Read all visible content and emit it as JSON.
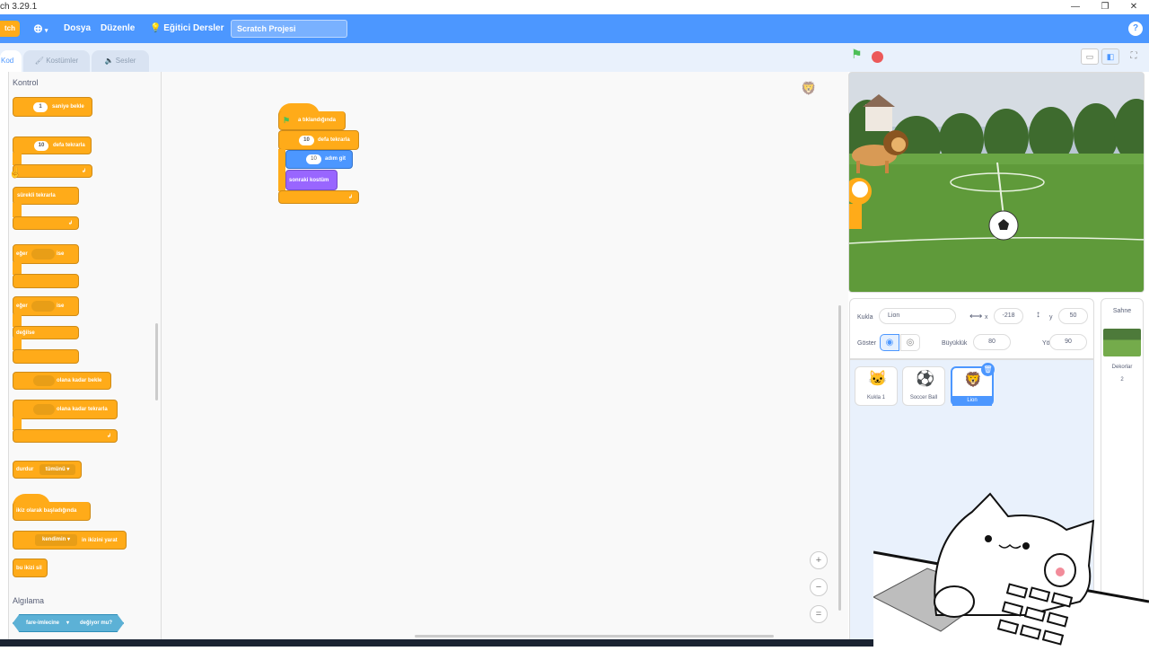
{
  "window": {
    "title": "ch 3.29.1",
    "minimize": "—",
    "maximize": "❐",
    "close": "✕"
  },
  "menubar": {
    "logo": "tch",
    "language_icon": "globe-icon",
    "file": "Dosya",
    "edit": "Düzenle",
    "tutorials": "Eğitici Dersler",
    "project_title": "Scratch Projesi",
    "help": "?"
  },
  "tabs": {
    "code": "Kod",
    "costumes": "Kostümler",
    "sounds": "Sesler"
  },
  "palette": {
    "category_title": "Kontrol",
    "blocks": {
      "wait_value": "1",
      "wait_label": "saniye bekle",
      "repeat_value": "10",
      "repeat_label": "defa tekrarla",
      "forever_label": "sürekli tekrarla",
      "if_label": "eğer",
      "then_label": "ise",
      "if2_label": "eğer",
      "then2_label": "ise",
      "else_label": "değilse",
      "wait_until_label": "olana kadar bekle",
      "repeat_until_label": "olana kadar tekrarla",
      "stop_label": "durdur",
      "stop_option": "tümünü",
      "clone_start_label": "ikiz olarak başladığında",
      "create_clone_option": "kendimin",
      "create_clone_label": "in ikizini yarat",
      "delete_clone_label": "bu ikizi sil"
    },
    "sensing_title": "Algılama",
    "sensing_block": {
      "option": "fare-imlecine",
      "label": "değiyor mu?"
    }
  },
  "script": {
    "hat": "a tıklandığında",
    "repeat_value": "10",
    "repeat_label": "defa tekrarla",
    "move_value": "10",
    "move_label": "adım git",
    "next_costume": "sonraki kostüm"
  },
  "sprite_info": {
    "sprite_label": "Kukla",
    "sprite_name": "Lion",
    "x_label": "x",
    "x_value": "-218",
    "y_label": "y",
    "y_value": "50",
    "show_label": "Göster",
    "size_label": "Büyüklük",
    "size_value": "80",
    "direction_label": "Yön",
    "direction_value": "90"
  },
  "sprites": [
    {
      "name": "Kukla 1",
      "icon": "cat-sprite-icon"
    },
    {
      "name": "Soccer Ball",
      "icon": "soccer-ball-icon"
    },
    {
      "name": "Lion",
      "icon": "lion-icon"
    }
  ],
  "stage_panel": {
    "title": "Sahne",
    "backdrops_label": "Dekorlar",
    "backdrops_count": "2"
  },
  "zoom": {
    "in": "+",
    "out": "−",
    "reset": "="
  },
  "colors": {
    "accent": "#4c97ff",
    "control": "#ffab19",
    "motion": "#4c97ff",
    "looks": "#9966ff",
    "sensing": "#5cb1d6"
  }
}
